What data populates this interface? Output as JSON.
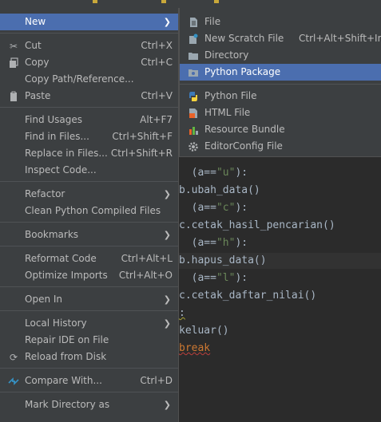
{
  "main_menu": {
    "new": "New",
    "cut": "Cut",
    "cut_sc": "Ctrl+X",
    "copy": "Copy",
    "copy_sc": "Ctrl+C",
    "copy_path": "Copy Path/Reference...",
    "paste": "Paste",
    "paste_sc": "Ctrl+V",
    "find_usages": "Find Usages",
    "find_usages_sc": "Alt+F7",
    "find_in_files": "Find in Files...",
    "find_in_files_sc": "Ctrl+Shift+F",
    "replace_in_files": "Replace in Files...",
    "replace_in_files_sc": "Ctrl+Shift+R",
    "inspect_code": "Inspect Code...",
    "refactor": "Refactor",
    "clean_compiled": "Clean Python Compiled Files",
    "bookmarks": "Bookmarks",
    "reformat_code": "Reformat Code",
    "reformat_code_sc": "Ctrl+Alt+L",
    "optimize_imports": "Optimize Imports",
    "optimize_imports_sc": "Ctrl+Alt+O",
    "open_in": "Open In",
    "local_history": "Local History",
    "repair_ide": "Repair IDE on File",
    "reload_from_disk": "Reload from Disk",
    "compare_with": "Compare With...",
    "compare_with_sc": "Ctrl+D",
    "mark_directory": "Mark Directory as"
  },
  "submenu": {
    "file": "File",
    "new_scratch": "New Scratch File",
    "new_scratch_sc": "Ctrl+Alt+Shift+Inse",
    "directory": "Directory",
    "python_package": "Python Package",
    "python_file": "Python File",
    "html_file": "HTML File",
    "resource_bundle": "Resource Bundle",
    "editorconfig": "EditorConfig File"
  },
  "code": {
    "l1_a": "(a==",
    "l1_s": "\"u\"",
    "l1_b": "):",
    "l2": "b.ubah_data()",
    "l3_a": "(a==",
    "l3_s": "\"c\"",
    "l3_b": "):",
    "l4": "c.cetak_hasil_pencarian()",
    "l5_a": "(a==",
    "l5_s": "\"h\"",
    "l5_b": "):",
    "l6": "b.hapus_data()",
    "l7_a": "(a==",
    "l7_s": "\"l\"",
    "l7_b": "):",
    "l8": "c.cetak_daftar_nilai()",
    "l9": ":",
    "l10": "keluar()",
    "l11": "break"
  },
  "colors": {
    "selection": "#4b6eaf",
    "menu_bg": "#3c3f41",
    "editor_bg": "#2b2b2b"
  }
}
